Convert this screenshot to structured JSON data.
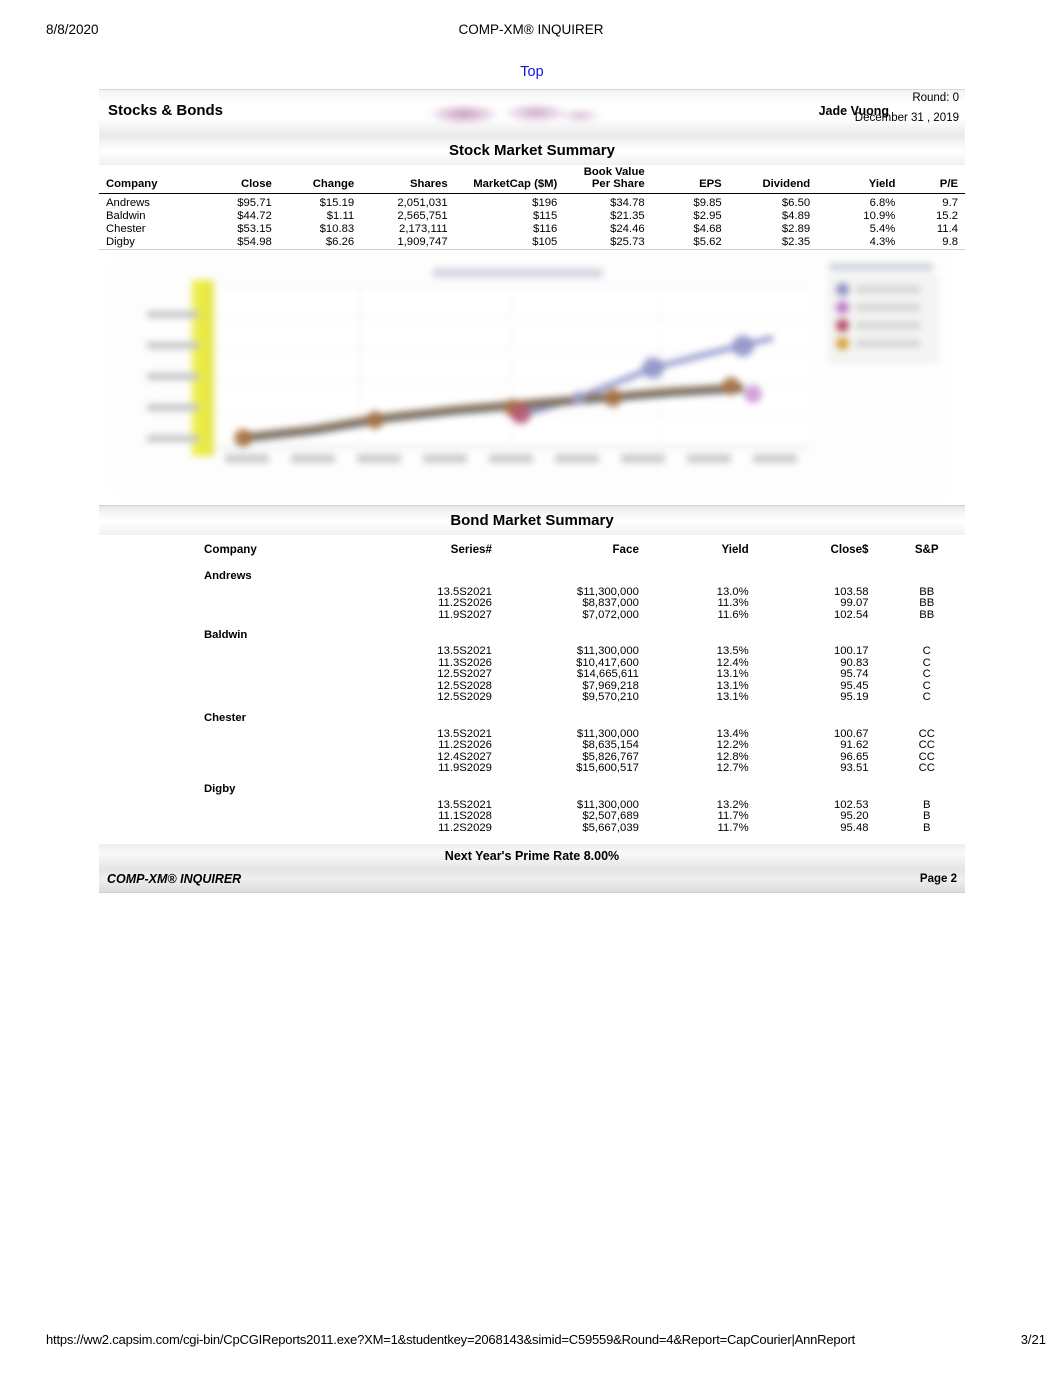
{
  "print": {
    "date": "8/8/2020",
    "doc_title": "COMP-XM® INQUIRER",
    "url": "https://ww2.capsim.com/cgi-bin/CpCGIReports2011.exe?XM=1&studentkey=2068143&simid=C59559&Round=4&Report=CapCourier|AnnReport",
    "page_indicator": "3/21"
  },
  "report": {
    "top_link": "Top",
    "title": "Stocks & Bonds",
    "user": "Jade Vuong",
    "round": "Round: 0",
    "date": "December 31 , 2019",
    "stock_section_title": "Stock Market Summary",
    "bond_section_title": "Bond Market Summary",
    "prime_rate": "Next Year's Prime Rate 8.00%",
    "footer_left": "COMP-XM® INQUIRER",
    "footer_right": "Page 2"
  },
  "stock_table": {
    "headers": [
      "Company",
      "Close",
      "Change",
      "Shares",
      "MarketCap ($M)",
      "Book Value Per Share",
      "EPS",
      "Dividend",
      "Yield",
      "P/E"
    ],
    "rows": [
      {
        "company": "Andrews",
        "close": "$95.71",
        "change": "$15.19",
        "shares": "2,051,031",
        "marketcap": "$196",
        "bookvalue": "$34.78",
        "eps": "$9.85",
        "dividend": "$6.50",
        "yield": "6.8%",
        "pe": "9.7"
      },
      {
        "company": "Baldwin",
        "close": "$44.72",
        "change": "$1.11",
        "shares": "2,565,751",
        "marketcap": "$115",
        "bookvalue": "$21.35",
        "eps": "$2.95",
        "dividend": "$4.89",
        "yield": "10.9%",
        "pe": "15.2"
      },
      {
        "company": "Chester",
        "close": "$53.15",
        "change": "$10.83",
        "shares": "2,173,111",
        "marketcap": "$116",
        "bookvalue": "$24.46",
        "eps": "$4.68",
        "dividend": "$2.89",
        "yield": "5.4%",
        "pe": "11.4"
      },
      {
        "company": "Digby",
        "close": "$54.98",
        "change": "$6.26",
        "shares": "1,909,747",
        "marketcap": "$105",
        "bookvalue": "$25.73",
        "eps": "$5.62",
        "dividend": "$2.35",
        "yield": "4.3%",
        "pe": "9.8"
      }
    ]
  },
  "bond_table": {
    "headers": [
      "Company",
      "Series#",
      "Face",
      "Yield",
      "Close$",
      "S&P"
    ],
    "groups": [
      {
        "company": "Andrews",
        "bonds": [
          {
            "series": "13.5S2021",
            "face": "$11,300,000",
            "yield": "13.0%",
            "close": "103.58",
            "sp": "BB"
          },
          {
            "series": "11.2S2026",
            "face": "$8,837,000",
            "yield": "11.3%",
            "close": "99.07",
            "sp": "BB"
          },
          {
            "series": "11.9S2027",
            "face": "$7,072,000",
            "yield": "11.6%",
            "close": "102.54",
            "sp": "BB"
          }
        ]
      },
      {
        "company": "Baldwin",
        "bonds": [
          {
            "series": "13.5S2021",
            "face": "$11,300,000",
            "yield": "13.5%",
            "close": "100.17",
            "sp": "C"
          },
          {
            "series": "11.3S2026",
            "face": "$10,417,600",
            "yield": "12.4%",
            "close": "90.83",
            "sp": "C"
          },
          {
            "series": "12.5S2027",
            "face": "$14,665,611",
            "yield": "13.1%",
            "close": "95.74",
            "sp": "C"
          },
          {
            "series": "12.5S2028",
            "face": "$7,969,218",
            "yield": "13.1%",
            "close": "95.45",
            "sp": "C"
          },
          {
            "series": "12.5S2029",
            "face": "$9,570,210",
            "yield": "13.1%",
            "close": "95.19",
            "sp": "C"
          }
        ]
      },
      {
        "company": "Chester",
        "bonds": [
          {
            "series": "13.5S2021",
            "face": "$11,300,000",
            "yield": "13.4%",
            "close": "100.67",
            "sp": "CC"
          },
          {
            "series": "11.2S2026",
            "face": "$8,635,154",
            "yield": "12.2%",
            "close": "91.62",
            "sp": "CC"
          },
          {
            "series": "12.4S2027",
            "face": "$5,826,767",
            "yield": "12.8%",
            "close": "96.65",
            "sp": "CC"
          },
          {
            "series": "11.9S2029",
            "face": "$15,600,517",
            "yield": "12.7%",
            "close": "93.51",
            "sp": "CC"
          }
        ]
      },
      {
        "company": "Digby",
        "bonds": [
          {
            "series": "13.5S2021",
            "face": "$11,300,000",
            "yield": "13.2%",
            "close": "102.53",
            "sp": "B"
          },
          {
            "series": "11.1S2028",
            "face": "$2,507,689",
            "yield": "11.7%",
            "close": "95.20",
            "sp": "B"
          },
          {
            "series": "11.2S2029",
            "face": "$5,667,039",
            "yield": "11.7%",
            "close": "95.48",
            "sp": "B"
          }
        ]
      }
    ]
  },
  "chart_data": {
    "type": "line",
    "title": "",
    "xlabel": "",
    "ylabel": "",
    "legend_position": "right",
    "grid": true,
    "note": "Stock price history chart rendered blurred/illegible in the source screenshot; tick labels, legend entries and title could not be read.",
    "categories": [
      "",
      "",
      "",
      "",
      "",
      "",
      "",
      "",
      ""
    ],
    "series": [
      {
        "name": "",
        "color": "#8a8ec6",
        "values": [
          null,
          null,
          null,
          null,
          0.4,
          0.62,
          0.8,
          0.88,
          null
        ]
      },
      {
        "name": "",
        "color": "#b07a4a",
        "values": [
          0.13,
          0.17,
          0.24,
          0.33,
          0.4,
          0.46,
          0.5,
          0.54,
          null
        ]
      },
      {
        "name": "",
        "color": "#c05a6a",
        "values": [
          null,
          null,
          null,
          null,
          0.34,
          null,
          null,
          null,
          null
        ]
      },
      {
        "name": "",
        "color": "#b57ac0",
        "values": [
          null,
          null,
          null,
          null,
          null,
          null,
          null,
          0.48,
          null
        ]
      }
    ],
    "highlight_bar": {
      "color": "#e7e73a",
      "position": 0
    }
  }
}
